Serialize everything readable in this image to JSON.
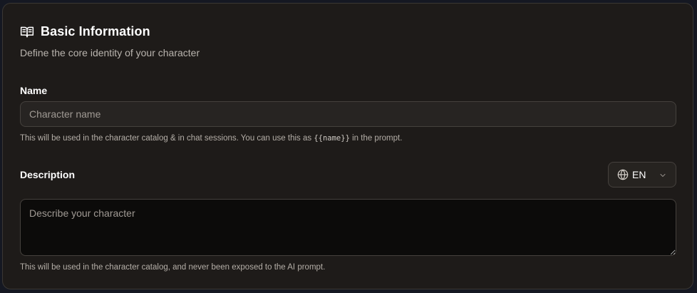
{
  "section": {
    "icon": "book-open-icon",
    "title": "Basic Information",
    "subtitle": "Define the core identity of your character"
  },
  "name_field": {
    "label": "Name",
    "placeholder": "Character name",
    "value": "",
    "hint_before": "This will be used in the character catalog & in chat sessions. You can use this as ",
    "hint_code": "{{name}}",
    "hint_after": " in the prompt."
  },
  "description_field": {
    "label": "Description",
    "placeholder": "Describe your character",
    "value": "",
    "hint": "This will be used in the character catalog, and never been exposed to the AI prompt."
  },
  "language_select": {
    "icon": "globe-icon",
    "selected": "EN",
    "chevron_icon": "chevron-down-icon"
  },
  "colors": {
    "card_background": "#1e1b19",
    "page_background": "#151822",
    "input_background": "#272422",
    "textarea_background": "#0c0b0a",
    "border": "#45413d",
    "text_primary": "#ffffff",
    "text_secondary": "#b9b4ae"
  }
}
